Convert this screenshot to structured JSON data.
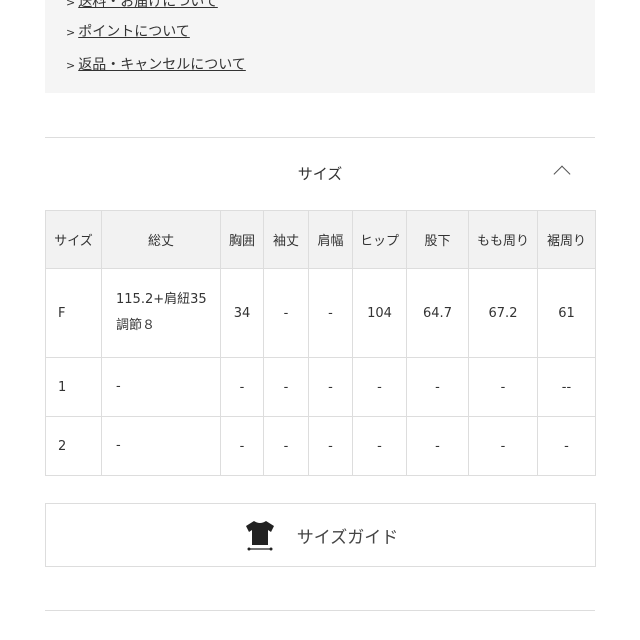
{
  "links": [
    {
      "label": "送料・お届けについて"
    },
    {
      "label": "ポイントについて"
    },
    {
      "label": "返品・キャンセルについて"
    }
  ],
  "section": {
    "title": "サイズ",
    "collapse_icon": "chevron-up-icon"
  },
  "table": {
    "headers": [
      "サイズ",
      "総丈",
      "胸囲",
      "袖丈",
      "肩幅",
      "ヒップ",
      "股下",
      "もも周り",
      "裾周り"
    ],
    "rows": [
      [
        "F",
        "115.2+肩紐35 調節８",
        "34",
        "-",
        "-",
        "104",
        "64.7",
        "67.2",
        "61"
      ],
      [
        "1",
        "-",
        "-",
        "-",
        "-",
        "-",
        "-",
        "-",
        "--"
      ],
      [
        "2",
        "-",
        "-",
        "-",
        "-",
        "-",
        "-",
        "-",
        "-"
      ]
    ]
  },
  "guide": {
    "label": "サイズガイド",
    "icon": "tshirt-icon"
  }
}
